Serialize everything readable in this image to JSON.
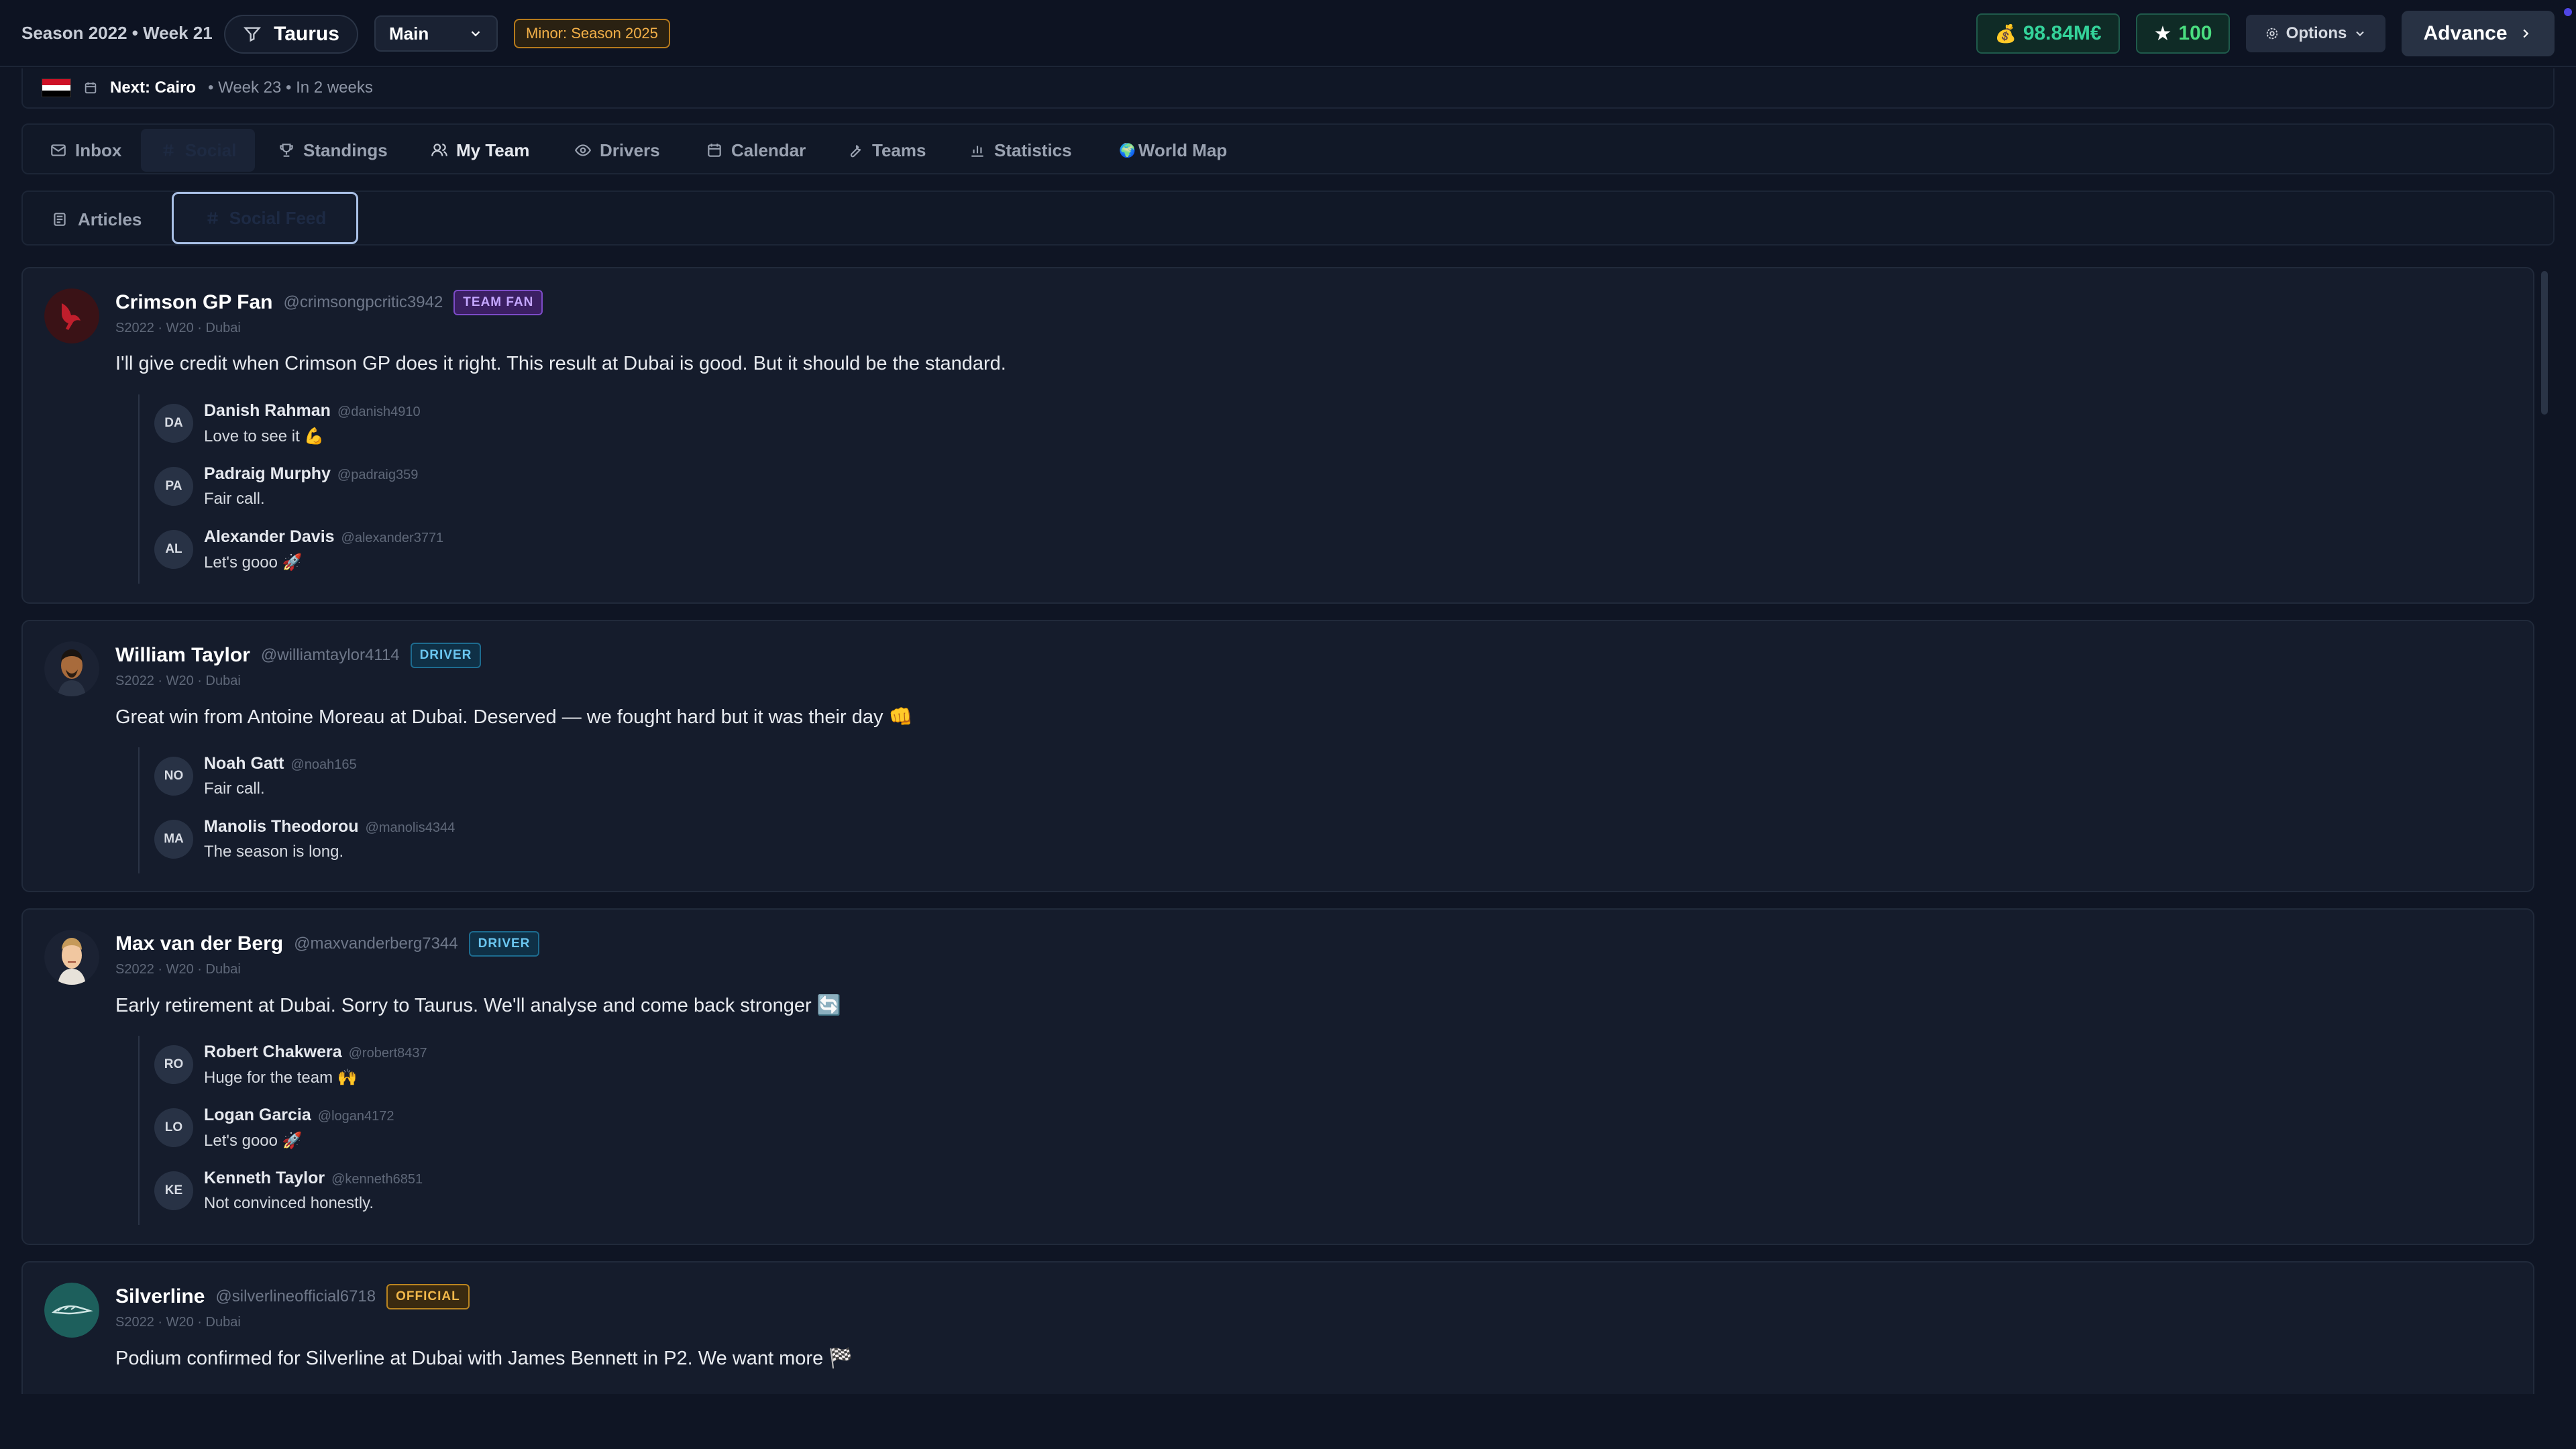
{
  "header": {
    "season": "Season 2022 • Week 21",
    "team_name": "Taurus",
    "save_select": "Main",
    "minor_badge": "Minor: Season 2025",
    "money": "98.84M€",
    "money_icon": "money-bag-icon",
    "reputation": "100",
    "options_label": "Options",
    "advance_label": "Advance"
  },
  "next_race": {
    "label": "Next: Cairo",
    "meta": "• Week 23 • In 2 weeks"
  },
  "nav": {
    "inbox": "Inbox",
    "social": "Social",
    "standings": "Standings",
    "my_team": "My Team",
    "drivers": "Drivers",
    "calendar": "Calendar",
    "teams": "Teams",
    "statistics": "Statistics",
    "world_map": "World Map"
  },
  "subtabs": {
    "articles": "Articles",
    "social_feed": "Social Feed"
  },
  "posts": [
    {
      "author": "Crimson GP Fan",
      "handle": "@crimsongpcritic3942",
      "badge": "TEAM FAN",
      "meta": "S2022 · W20 · Dubai",
      "text": "I'll give credit when Crimson GP does it right. This result at Dubai is good. But it should be the standard.",
      "replies": [
        {
          "initials": "DA",
          "name": "Danish Rahman",
          "handle": "@danish4910",
          "text": "Love to see it 💪"
        },
        {
          "initials": "PA",
          "name": "Padraig Murphy",
          "handle": "@padraig359",
          "text": "Fair call."
        },
        {
          "initials": "AL",
          "name": "Alexander Davis",
          "handle": "@alexander3771",
          "text": "Let's gooo 🚀"
        }
      ]
    },
    {
      "author": "William Taylor",
      "handle": "@williamtaylor4114",
      "badge": "DRIVER",
      "meta": "S2022 · W20 · Dubai",
      "text": "Great win from Antoine Moreau at Dubai. Deserved — we fought hard but it was their day 👊",
      "replies": [
        {
          "initials": "NO",
          "name": "Noah Gatt",
          "handle": "@noah165",
          "text": "Fair call."
        },
        {
          "initials": "MA",
          "name": "Manolis Theodorou",
          "handle": "@manolis4344",
          "text": "The season is long."
        }
      ]
    },
    {
      "author": "Max van der Berg",
      "handle": "@maxvanderberg7344",
      "badge": "DRIVER",
      "meta": "S2022 · W20 · Dubai",
      "text": "Early retirement at Dubai. Sorry to Taurus. We'll analyse and come back stronger 🔄",
      "replies": [
        {
          "initials": "RO",
          "name": "Robert Chakwera",
          "handle": "@robert8437",
          "text": "Huge for the team 🙌"
        },
        {
          "initials": "LO",
          "name": "Logan Garcia",
          "handle": "@logan4172",
          "text": "Let's gooo 🚀"
        },
        {
          "initials": "KE",
          "name": "Kenneth Taylor",
          "handle": "@kenneth6851",
          "text": "Not convinced honestly."
        }
      ]
    },
    {
      "author": "Silverline",
      "handle": "@silverlineofficial6718",
      "badge": "OFFICIAL",
      "meta": "S2022 · W20 · Dubai",
      "text": "Podium confirmed for Silverline at Dubai with James Bennett in P2. We want more 🏁",
      "replies": []
    }
  ],
  "colors": {
    "background": "#0f1524",
    "card": "#151c2c",
    "money_green": "#34d39a",
    "minor_amber": "#f3b048"
  }
}
